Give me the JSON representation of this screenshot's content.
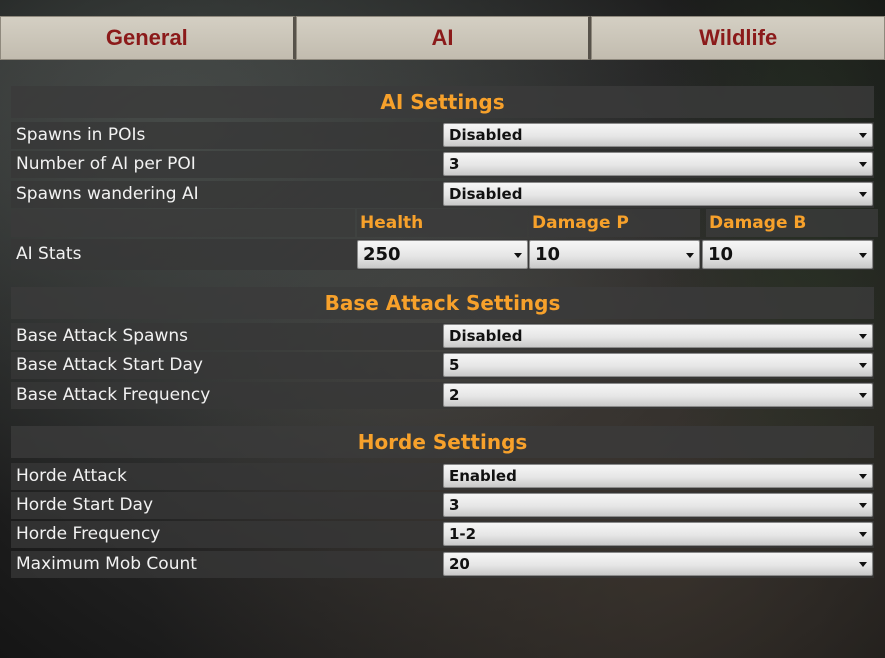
{
  "tabs": [
    {
      "label": "General"
    },
    {
      "label": "AI"
    },
    {
      "label": "Wildlife"
    }
  ],
  "ai_settings": {
    "title": "AI Settings",
    "rows": [
      {
        "label": "Spawns in POIs",
        "value": "Disabled"
      },
      {
        "label": "Number of AI per POI",
        "value": "3"
      },
      {
        "label": "Spawns wandering AI",
        "value": "Disabled"
      }
    ],
    "stats": {
      "label": "AI Stats",
      "health_header": "Health",
      "damage_p_header": "Damage P",
      "damage_b_header": "Damage B",
      "health": "250",
      "damage_p": "10",
      "damage_b": "10"
    }
  },
  "base_attack_settings": {
    "title": "Base Attack Settings",
    "rows": [
      {
        "label": "Base Attack Spawns",
        "value": "Disabled"
      },
      {
        "label": "Base Attack Start Day",
        "value": "5"
      },
      {
        "label": "Base Attack Frequency",
        "value": "2"
      }
    ]
  },
  "horde_settings": {
    "title": "Horde Settings",
    "rows": [
      {
        "label": "Horde Attack",
        "value": "Enabled"
      },
      {
        "label": "Horde Start Day",
        "value": "3"
      },
      {
        "label": "Horde Frequency",
        "value": "1-2"
      },
      {
        "label": "Maximum Mob Count",
        "value": "20"
      }
    ]
  },
  "colors": {
    "accent": "#f7a12b",
    "tab_text": "#8b1a1a",
    "label_text": "#f2f2f2"
  },
  "icons": {
    "dropdown": "chevron-down-icon"
  }
}
